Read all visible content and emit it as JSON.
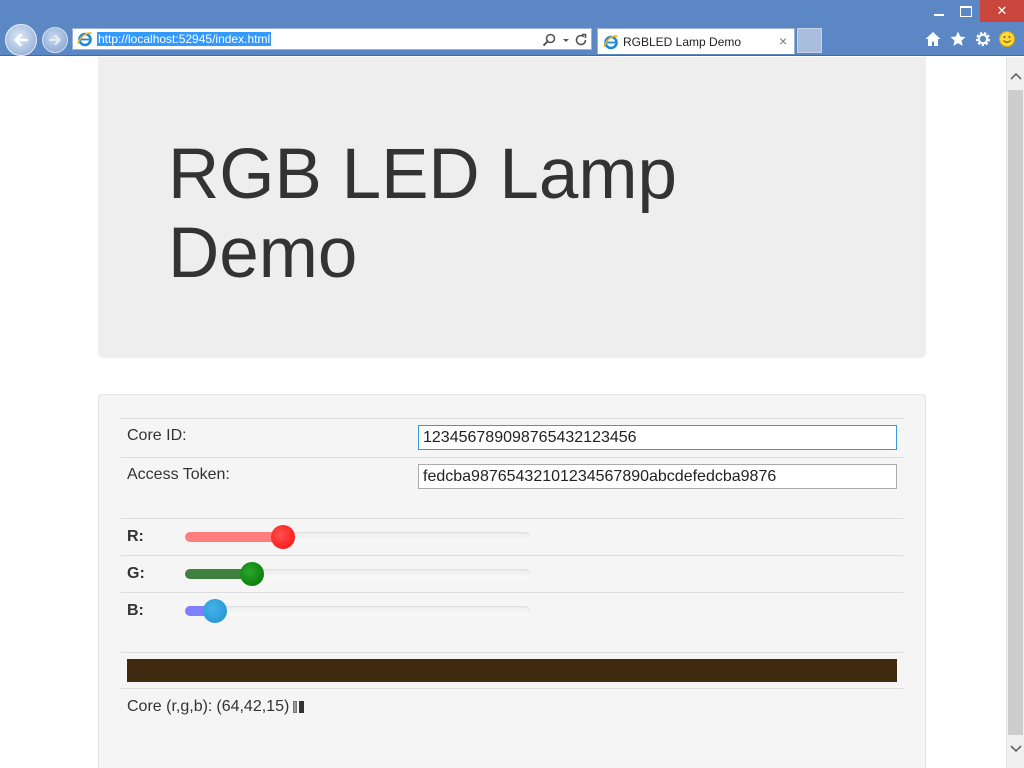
{
  "browser": {
    "url": "http://localhost:52945/index.html",
    "tab_title": "RGBLED Lamp Demo",
    "tab_close": "×",
    "window_close": "✕"
  },
  "page": {
    "title": "RGB LED Lamp Demo",
    "core_id_label": "Core ID:",
    "core_id_value": "123456789098765432123456",
    "access_token_label": "Access Token:",
    "access_token_value": "fedcba98765432101234567890abcdefedcba9876",
    "sliders": {
      "r": {
        "label": "R:",
        "level": 0.254
      },
      "g": {
        "label": "G:",
        "level": 0.165
      },
      "b": {
        "label": "B:",
        "level": 0.059
      }
    },
    "swatch_color": "#402a0f",
    "status_prefix": "Core (r,g,b):",
    "status_value": "(64,42,15)"
  },
  "icons": [
    "back-arrow-icon",
    "forward-arrow-icon",
    "ie-logo-icon",
    "search-icon",
    "refresh-icon",
    "home-icon",
    "star-icon",
    "gear-icon",
    "smiley-icon"
  ]
}
